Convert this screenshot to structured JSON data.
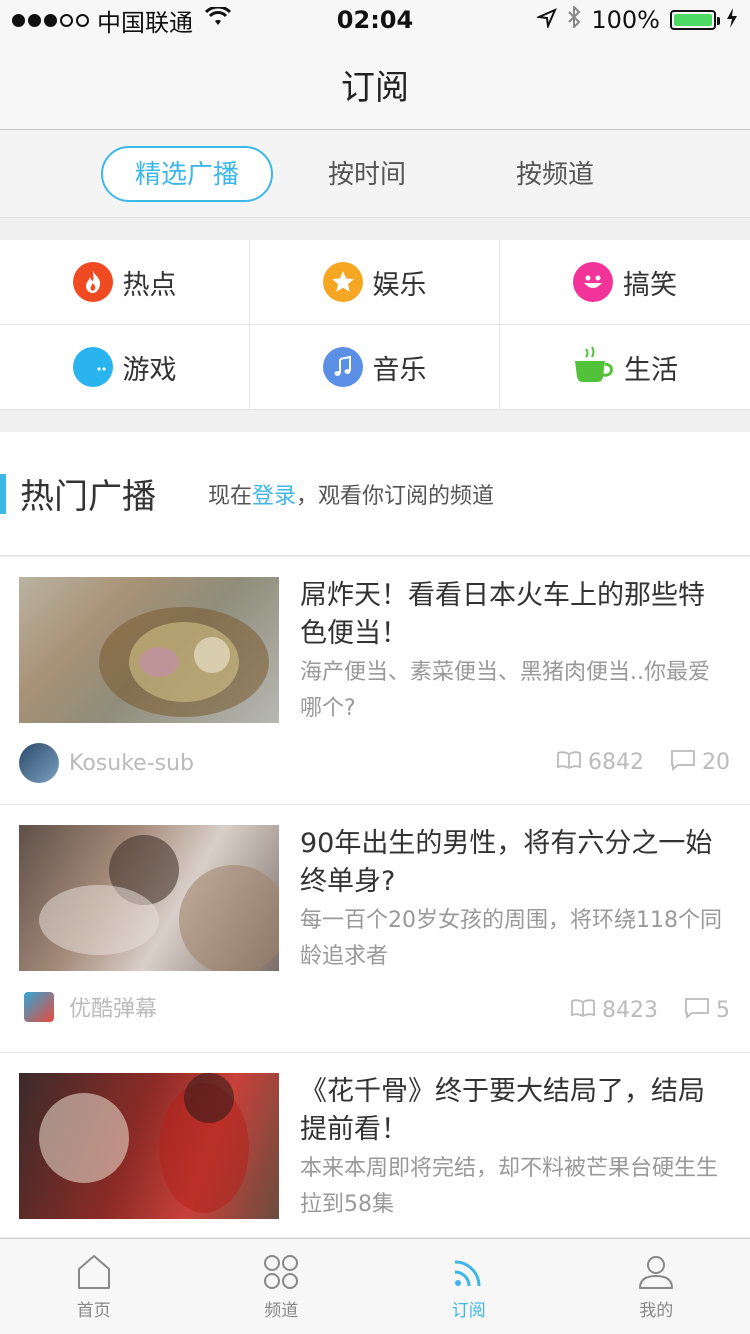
{
  "status_bar": {
    "carrier": "中国联通",
    "time": "02:04",
    "battery": "100%",
    "battery_level": 1.0
  },
  "nav": {
    "title": "订阅"
  },
  "segments": [
    {
      "label": "精选广播",
      "active": true
    },
    {
      "label": "按时间",
      "active": false
    },
    {
      "label": "按频道",
      "active": false
    }
  ],
  "categories": [
    {
      "label": "热点",
      "icon": "fire-icon",
      "color": "#f04a22"
    },
    {
      "label": "娱乐",
      "icon": "star-icon",
      "color": "#f5a623"
    },
    {
      "label": "搞笑",
      "icon": "smile-icon",
      "color": "#f2339a"
    },
    {
      "label": "游戏",
      "icon": "pacman-icon",
      "color": "#2ab4ef"
    },
    {
      "label": "音乐",
      "icon": "music-note-icon",
      "color": "#5b8fe6"
    },
    {
      "label": "生活",
      "icon": "coffee-cup-icon",
      "color": "#52c23a"
    }
  ],
  "hot": {
    "title": "热门广播",
    "tip_prefix": "现在",
    "tip_link": "登录",
    "tip_suffix": "，观看你订阅的频道"
  },
  "feed": [
    {
      "title": "屌炸天！看看日本火车上的那些特色便当！",
      "desc": "海产便当、素菜便当、黑猪肉便当..你最爱哪个?",
      "author": "Kosuke-sub",
      "views": "6842",
      "comments": "20"
    },
    {
      "title": "90年出生的男性，将有六分之一始终单身?",
      "desc": "每一百个20岁女孩的周围，将环绕118个同龄追求者",
      "author": "优酷弹幕",
      "views": "8423",
      "comments": "5"
    },
    {
      "title": "《花千骨》终于要大结局了，结局提前看！",
      "desc": "本来本周即将完结，却不料被芒果台硬生生拉到58集",
      "author": "",
      "views": "",
      "comments": ""
    }
  ],
  "tab_bar": [
    {
      "label": "首页",
      "icon": "home-icon",
      "active": false
    },
    {
      "label": "频道",
      "icon": "grid-circles-icon",
      "active": false
    },
    {
      "label": "订阅",
      "icon": "rss-icon",
      "active": true
    },
    {
      "label": "我的",
      "icon": "user-icon",
      "active": false
    }
  ],
  "colors": {
    "accent": "#3db7e8"
  }
}
